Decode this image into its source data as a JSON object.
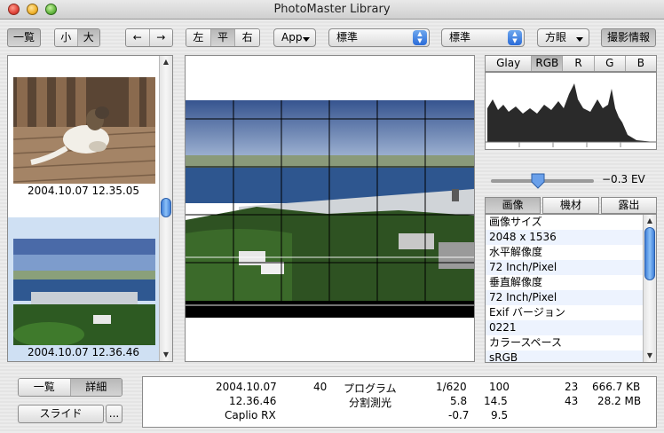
{
  "window": {
    "title": "PhotoMaster Library"
  },
  "toolbar": {
    "list_label": "一覧",
    "size_small": "小",
    "size_large": "大",
    "nav_back": "←",
    "nav_forward": "→",
    "align_left": "左",
    "align_center": "平",
    "align_right": "右",
    "app_label": "App",
    "popup1_value": "標準",
    "popup2_value": "標準",
    "grid_label": "方眼",
    "shooting_info_label": "撮影情報"
  },
  "thumbnails": [
    {
      "caption": "2004.10.07    12.35.05",
      "selected": false
    },
    {
      "caption": "2004.10.07    12.36.46",
      "selected": true
    }
  ],
  "histogram": {
    "tabs": [
      "Glay",
      "RGB",
      "R",
      "G",
      "B"
    ],
    "active_tab": "RGB"
  },
  "exposure": {
    "value_label": "−0.3 EV",
    "level": -0.3
  },
  "info": {
    "tabs": [
      "画像",
      "機材",
      "露出"
    ],
    "active_tab": "画像",
    "rows": [
      "画像サイズ",
      "2048 x 1536",
      "水平解像度",
      "72 Inch/Pixel",
      "垂直解像度",
      "72 Inch/Pixel",
      "Exif バージョン",
      "0221",
      "カラースペース",
      "sRGB"
    ]
  },
  "bottom_left": {
    "list_label": "一覧",
    "detail_label": "詳細",
    "slide_label": "スライド",
    "more_label": "..."
  },
  "details": {
    "date": "2004.10.07",
    "time": "12.36.46",
    "camera": "Caplio RX",
    "num1": "40",
    "mode": "プログラム",
    "metering": "分割測光",
    "shutter": "1/620",
    "aperture": "5.8",
    "ev": "-0.7",
    "iso": "100",
    "focal": "14.5",
    "f9": "9.5",
    "c1": "23",
    "c2": "43",
    "size1": "666.7 KB",
    "size2": "28.2 MB"
  }
}
